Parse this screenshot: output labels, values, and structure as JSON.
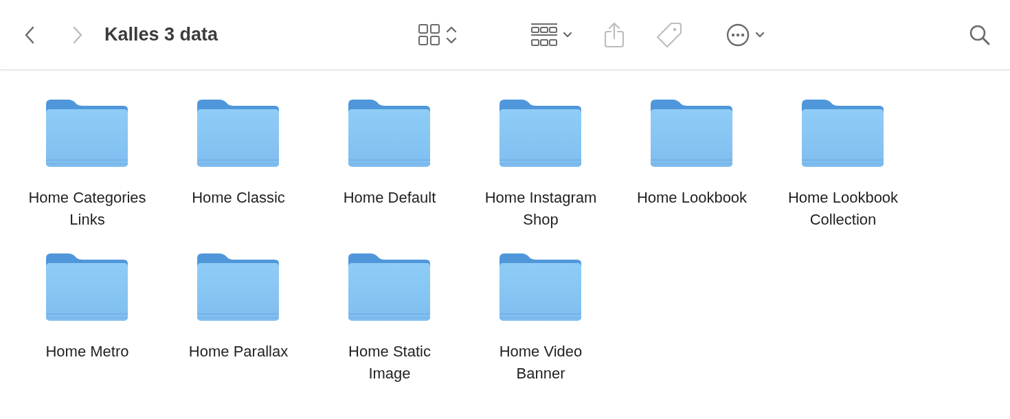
{
  "toolbar": {
    "back": {
      "disabled": false
    },
    "forward": {
      "disabled": true
    },
    "title": "Kalles 3 data",
    "share": {
      "disabled": true
    },
    "tag": {
      "disabled": true
    }
  },
  "folders": [
    {
      "name": "Home Categories Links"
    },
    {
      "name": "Home Classic"
    },
    {
      "name": "Home Default"
    },
    {
      "name": "Home Instagram Shop"
    },
    {
      "name": "Home Lookbook"
    },
    {
      "name": "Home Lookbook Collection"
    },
    {
      "name": "Home Metro"
    },
    {
      "name": "Home Parallax"
    },
    {
      "name": "Home Static Image"
    },
    {
      "name": "Home Video Banner"
    }
  ]
}
